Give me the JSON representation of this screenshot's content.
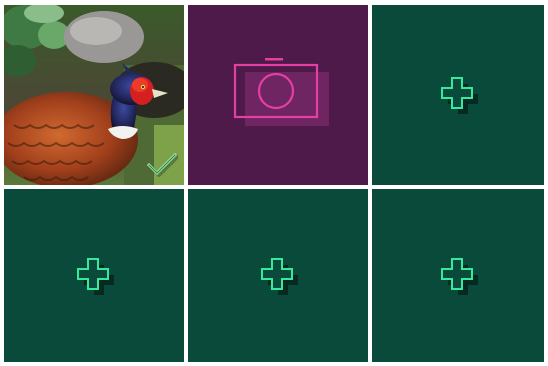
{
  "colors": {
    "add_tile_bg": "#094a3a",
    "camera_tile_bg": "#4d1a4a",
    "accent_green": "#38e89c",
    "accent_pink": "#e63fa3",
    "gap": "#ffffff"
  },
  "grid": {
    "tiles": [
      {
        "kind": "photo",
        "icon": "pheasant-photo",
        "selected": true
      },
      {
        "kind": "camera",
        "icon": "camera-icon"
      },
      {
        "kind": "add",
        "icon": "plus-icon"
      },
      {
        "kind": "add",
        "icon": "plus-icon"
      },
      {
        "kind": "add",
        "icon": "plus-icon"
      },
      {
        "kind": "add",
        "icon": "plus-icon"
      }
    ]
  }
}
